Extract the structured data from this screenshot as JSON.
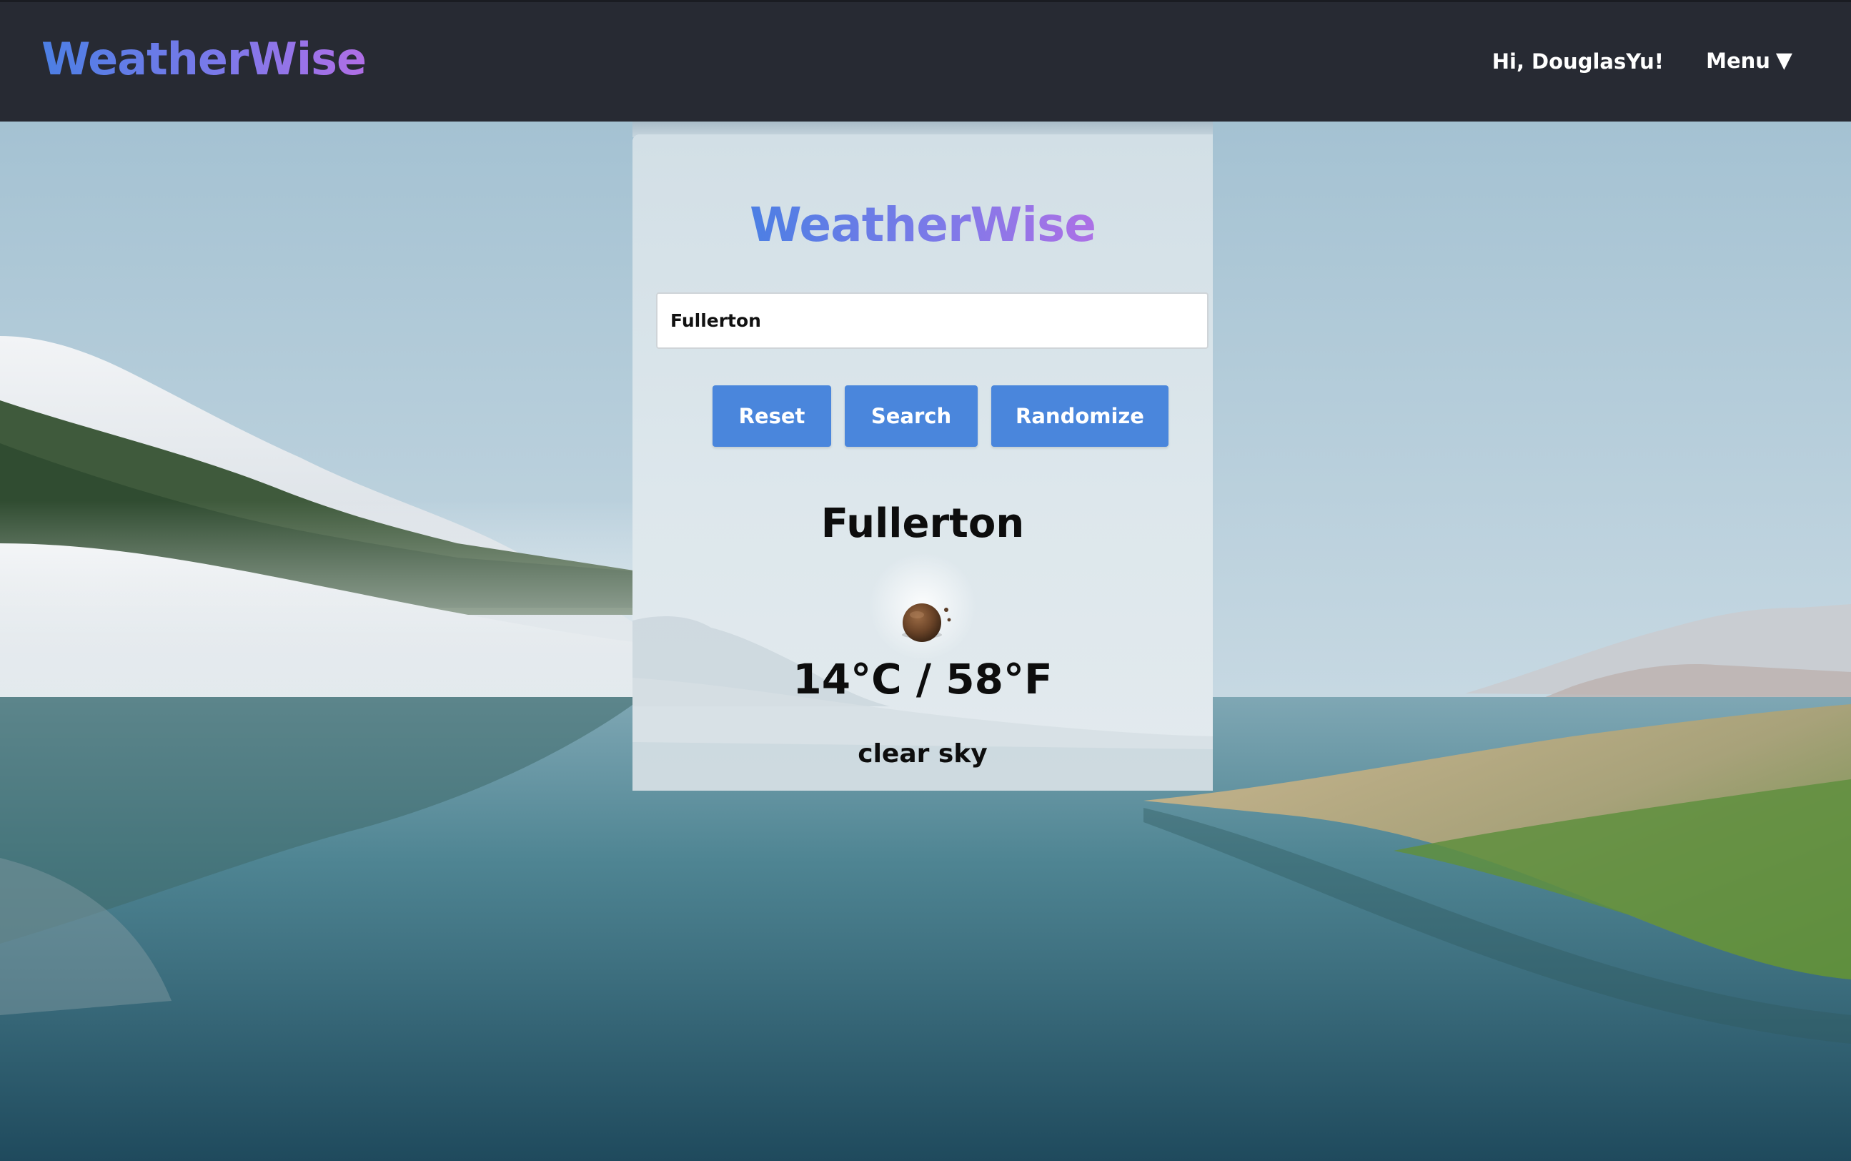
{
  "header": {
    "brand": "WeatherWise",
    "greeting": "Hi, DouglasYu!",
    "menu_label": "Menu",
    "menu_caret": "▼"
  },
  "card": {
    "logo": "WeatherWise",
    "search_value": "Fullerton",
    "buttons": {
      "reset": "Reset",
      "search": "Search",
      "randomize": "Randomize"
    },
    "weather": {
      "city": "Fullerton",
      "icon": "clear-night-moon-icon",
      "temperature": "14°C / 58°F",
      "description": "clear sky"
    }
  },
  "colors": {
    "topbar": "#272a33",
    "button": "#4a86dc",
    "brand_gradient_start": "#4c7fe4",
    "brand_gradient_end": "#b06ee6"
  }
}
